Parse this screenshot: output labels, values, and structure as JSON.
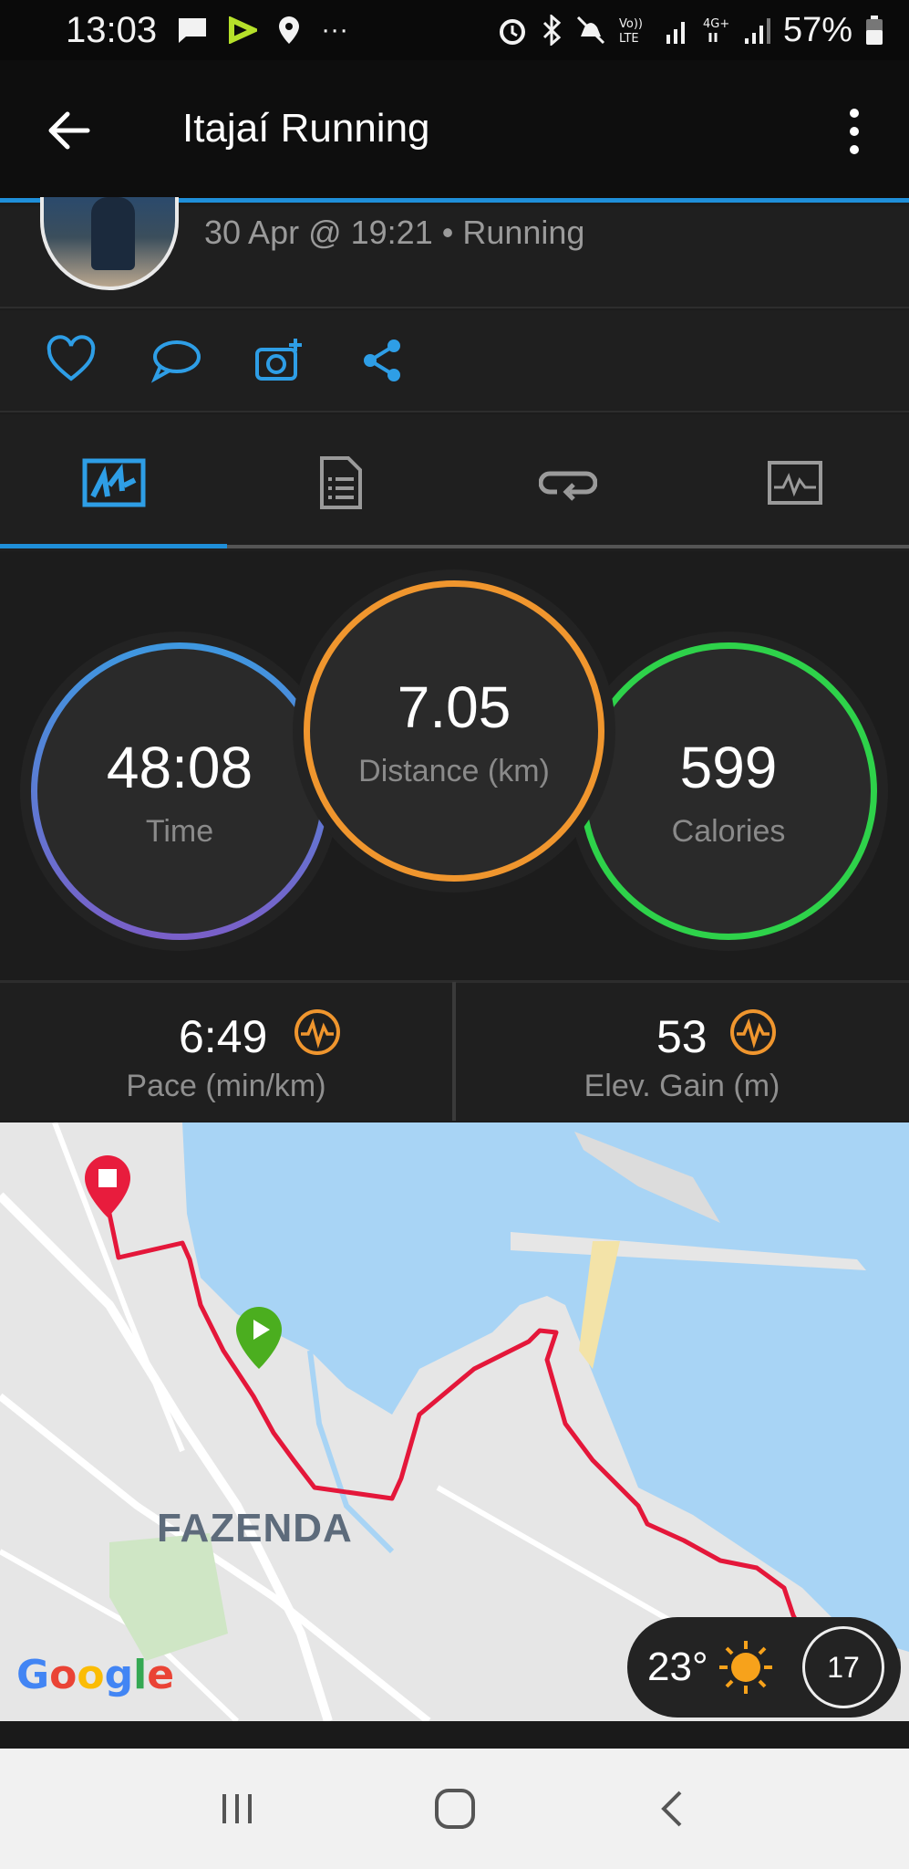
{
  "status_bar": {
    "time": "13:03",
    "battery": "57%"
  },
  "app_bar": {
    "title": "Itajaí Running"
  },
  "activity": {
    "subtitle": "30 Apr @ 19:21 • Running"
  },
  "stats": {
    "time": {
      "value": "48:08",
      "label": "Time"
    },
    "distance": {
      "value": "7.05",
      "label": "Distance (km)"
    },
    "calories": {
      "value": "599",
      "label": "Calories"
    }
  },
  "metrics": {
    "pace": {
      "value": "6:49",
      "label": "Pace (min/km)"
    },
    "elevation": {
      "value": "53",
      "label": "Elev. Gain (m)"
    }
  },
  "map": {
    "place_label": "FAZENDA",
    "attribution": "Google"
  },
  "weather": {
    "temperature": "23°",
    "wind": "17"
  },
  "colors": {
    "accent": "#1f8fd9",
    "time_ring": "#4a8fd8",
    "distance_ring": "#f0962e",
    "calories_ring": "#2ed24a",
    "route": "#e4173a",
    "water": "#a8d4f5"
  }
}
